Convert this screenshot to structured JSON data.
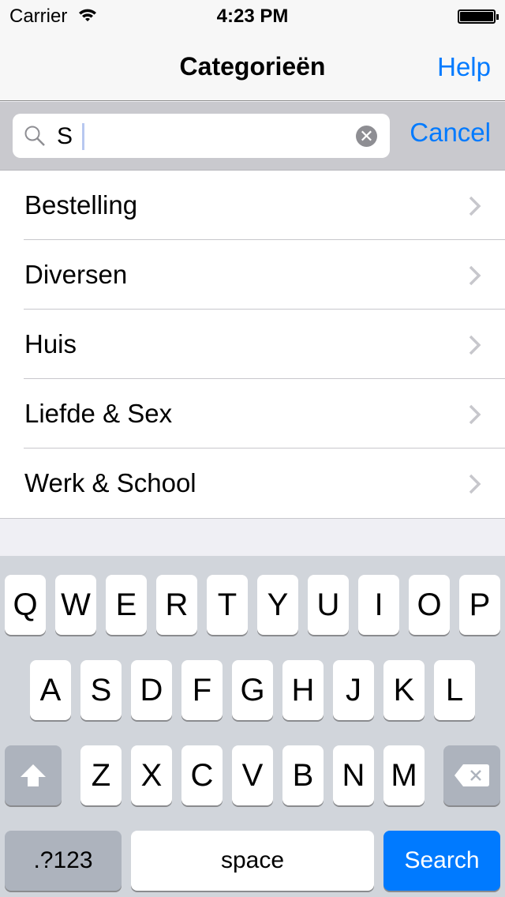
{
  "status": {
    "carrier": "Carrier",
    "time": "4:23 PM"
  },
  "nav": {
    "title": "Categorieën",
    "help": "Help"
  },
  "search": {
    "value": "S",
    "cancel": "Cancel"
  },
  "list": [
    {
      "label": "Bestelling"
    },
    {
      "label": "Diversen"
    },
    {
      "label": "Huis"
    },
    {
      "label": "Liefde & Sex"
    },
    {
      "label": "Werk & School"
    }
  ],
  "keyboard": {
    "rows": [
      [
        "Q",
        "W",
        "E",
        "R",
        "T",
        "Y",
        "U",
        "I",
        "O",
        "P"
      ],
      [
        "A",
        "S",
        "D",
        "F",
        "G",
        "H",
        "J",
        "K",
        "L"
      ],
      [
        "Z",
        "X",
        "C",
        "V",
        "B",
        "N",
        "M"
      ]
    ],
    "numbers": ".?123",
    "space": "space",
    "search": "Search",
    "accent": "#007aff"
  }
}
